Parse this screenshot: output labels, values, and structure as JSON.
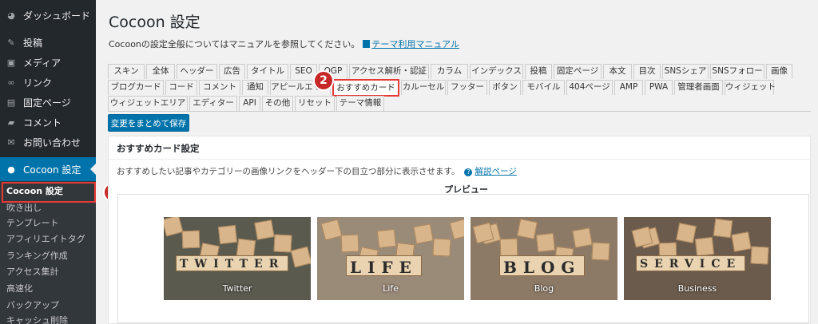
{
  "sidebar": {
    "dashboard": "ダッシュボード",
    "items": [
      {
        "label": "投稿",
        "icon": "pin-icon"
      },
      {
        "label": "メディア",
        "icon": "media-icon"
      },
      {
        "label": "リンク",
        "icon": "link-icon"
      },
      {
        "label": "固定ページ",
        "icon": "page-icon"
      },
      {
        "label": "コメント",
        "icon": "comment-icon"
      },
      {
        "label": "お問い合わせ",
        "icon": "mail-icon"
      }
    ],
    "current": "Cocoon 設定",
    "submenu": [
      "Cocoon 設定",
      "吹き出し",
      "テンプレート",
      "アフィリエイトタグ",
      "ランキング作成",
      "アクセス集計",
      "高速化",
      "バックアップ",
      "キャッシュ削除"
    ]
  },
  "badges": [
    "1",
    "2"
  ],
  "header": {
    "title": "Cocoon 設定",
    "desc": "Cocoonの設定全般についてはマニュアルを参照してください。",
    "manual_link": "テーマ利用マニュアル"
  },
  "tabs": {
    "row1": [
      "スキン",
      "全体",
      "ヘッダー",
      "広告",
      "タイトル",
      "SEO",
      "OGP",
      "アクセス解析・認証",
      "カラム",
      "インデックス",
      "投稿",
      "固定ページ",
      "本文",
      "目次",
      "SNSシェア",
      "SNSフォロー",
      "画像"
    ],
    "row2": [
      "ブログカード",
      "コード",
      "コメント",
      "通知",
      "アピールエリア",
      "おすすめカード",
      "カルーセル",
      "フッター",
      "ボタン",
      "モバイル",
      "404ページ",
      "AMP",
      "PWA",
      "管理者画面",
      "ウィジェット"
    ],
    "row3": [
      "ウィジェットエリア",
      "エディター",
      "API",
      "その他",
      "リセット",
      "テーマ情報"
    ]
  },
  "save_button": "変更をまとめて保存",
  "panel": {
    "title": "おすすめカード設定",
    "desc": "おすすめしたい記事やカテゴリーの画像リンクをヘッダー下の目立つ部分に表示させます。",
    "help_link": "解説ページ",
    "preview_label": "プレビュー",
    "cards": [
      {
        "word": "TWITTER",
        "caption": "Twitter",
        "bg": "#5a5a4e"
      },
      {
        "word": "LIFE",
        "caption": "Life",
        "bg": "#9a8a78"
      },
      {
        "word": "BLOG",
        "caption": "Blog",
        "bg": "#8d7a66"
      },
      {
        "word": "SERVICE",
        "caption": "Business",
        "bg": "#6b5b4c"
      }
    ]
  }
}
